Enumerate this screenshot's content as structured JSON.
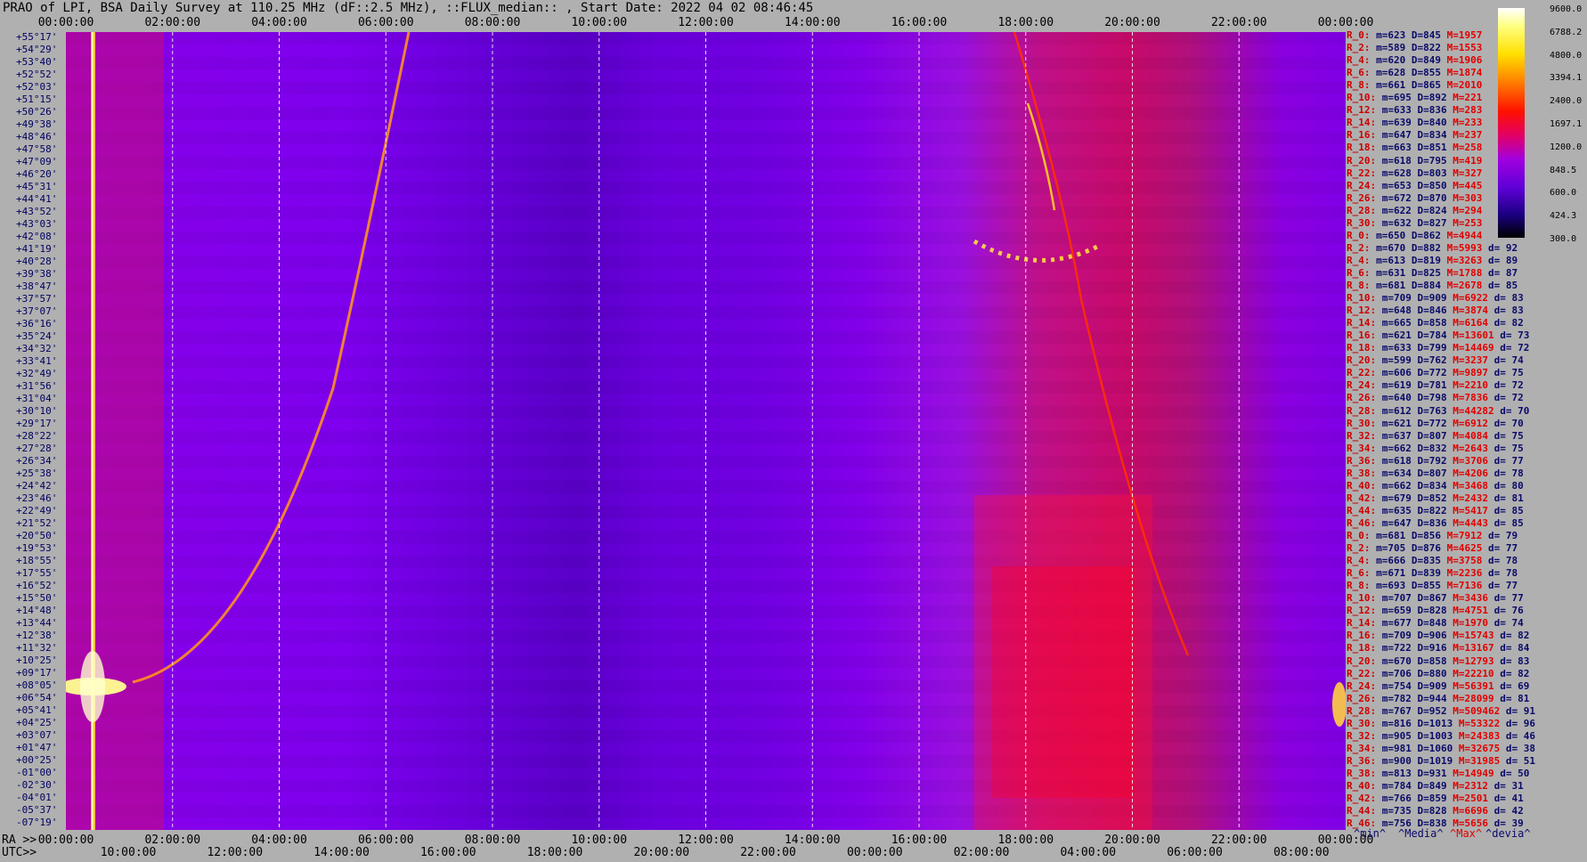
{
  "title": "PRAO of LPI, BSA Daily Survey at 110.25 MHz (dF::2.5 MHz), ::FLUX_median:: , Start Date: 2022 04 02 08:46:45",
  "top_ticks": [
    "00:00:00",
    "02:00:00",
    "04:00:00",
    "06:00:00",
    "08:00:00",
    "10:00:00",
    "12:00:00",
    "14:00:00",
    "16:00:00",
    "18:00:00",
    "20:00:00",
    "22:00:00",
    "00:00:00"
  ],
  "ra_label": "RA >>",
  "utc_label": "UTC>>",
  "bottom_ra_ticks": [
    "00:00:00",
    "02:00:00",
    "04:00:00",
    "06:00:00",
    "08:00:00",
    "10:00:00",
    "12:00:00",
    "14:00:00",
    "16:00:00",
    "18:00:00",
    "20:00:00",
    "22:00:00",
    "00:00:00"
  ],
  "bottom_utc_ticks": [
    "10:00:00",
    "12:00:00",
    "14:00:00",
    "16:00:00",
    "18:00:00",
    "20:00:00",
    "22:00:00",
    "00:00:00",
    "02:00:00",
    "04:00:00",
    "06:00:00",
    "08:00:00"
  ],
  "declinations": [
    "+55°17'",
    "+54°29'",
    "+53°40'",
    "+52°52'",
    "+52°03'",
    "+51°15'",
    "+50°26'",
    "+49°38'",
    "+48°46'",
    "+47°58'",
    "+47°09'",
    "+46°20'",
    "+45°31'",
    "+44°41'",
    "+43°52'",
    "+43°03'",
    "+42°08'",
    "+41°19'",
    "+40°28'",
    "+39°38'",
    "+38°47'",
    "+37°57'",
    "+37°07'",
    "+36°16'",
    "+35°24'",
    "+34°32'",
    "+33°41'",
    "+32°49'",
    "+31°56'",
    "+31°04'",
    "+30°10'",
    "+29°17'",
    "+28°22'",
    "+27°28'",
    "+26°34'",
    "+25°38'",
    "+24°42'",
    "+23°46'",
    "+22°49'",
    "+21°52'",
    "+20°50'",
    "+19°53'",
    "+18°55'",
    "+17°55'",
    "+16°52'",
    "+15°50'",
    "+14°48'",
    "+13°44'",
    "+12°38'",
    "+11°32'",
    "+10°25'",
    "+09°17'",
    "+08°05'",
    "+06°54'",
    "+05°41'",
    "+04°25'",
    "+03°07'",
    "+01°47'",
    "+00°25'",
    "-01°00'",
    "-02°30'",
    "-04°01'",
    "-05°37'",
    "-07°19'"
  ],
  "stats_rows": [
    {
      "n": "R_0:",
      "min": "m=623",
      "med": "D=845",
      "max": "M=1957",
      "dev": ""
    },
    {
      "n": "R_2:",
      "min": "m=589",
      "med": "D=822",
      "max": "M=1553",
      "dev": ""
    },
    {
      "n": "R_4:",
      "min": "m=620",
      "med": "D=849",
      "max": "M=1906",
      "dev": ""
    },
    {
      "n": "R_6:",
      "min": "m=628",
      "med": "D=855",
      "max": "M=1874",
      "dev": ""
    },
    {
      "n": "R_8:",
      "min": "m=661",
      "med": "D=865",
      "max": "M=2010",
      "dev": ""
    },
    {
      "n": "R_10:",
      "min": "m=695",
      "med": "D=892",
      "max": "M=221",
      "dev": ""
    },
    {
      "n": "R_12:",
      "min": "m=633",
      "med": "D=836",
      "max": "M=283",
      "dev": ""
    },
    {
      "n": "R_14:",
      "min": "m=639",
      "med": "D=840",
      "max": "M=233",
      "dev": ""
    },
    {
      "n": "R_16:",
      "min": "m=647",
      "med": "D=834",
      "max": "M=237",
      "dev": ""
    },
    {
      "n": "R_18:",
      "min": "m=663",
      "med": "D=851",
      "max": "M=258",
      "dev": ""
    },
    {
      "n": "R_20:",
      "min": "m=618",
      "med": "D=795",
      "max": "M=419",
      "dev": ""
    },
    {
      "n": "R_22:",
      "min": "m=628",
      "med": "D=803",
      "max": "M=327",
      "dev": ""
    },
    {
      "n": "R_24:",
      "min": "m=653",
      "med": "D=850",
      "max": "M=445",
      "dev": ""
    },
    {
      "n": "R_26:",
      "min": "m=672",
      "med": "D=870",
      "max": "M=303",
      "dev": ""
    },
    {
      "n": "R_28:",
      "min": "m=622",
      "med": "D=824",
      "max": "M=294",
      "dev": ""
    },
    {
      "n": "R_30:",
      "min": "m=632",
      "med": "D=827",
      "max": "M=253",
      "dev": ""
    },
    {
      "n": "R_0:",
      "min": "m=650",
      "med": "D=862",
      "max": "M=4944",
      "dev": ""
    },
    {
      "n": "R_2:",
      "min": "m=670",
      "med": "D=882",
      "max": "M=5993",
      "dev": "d= 92"
    },
    {
      "n": "R_4:",
      "min": "m=613",
      "med": "D=819",
      "max": "M=3263",
      "dev": "d= 89"
    },
    {
      "n": "R_6:",
      "min": "m=631",
      "med": "D=825",
      "max": "M=1788",
      "dev": "d= 87"
    },
    {
      "n": "R_8:",
      "min": "m=681",
      "med": "D=884",
      "max": "M=2678",
      "dev": "d= 85"
    },
    {
      "n": "R_10:",
      "min": "m=709",
      "med": "D=909",
      "max": "M=6922",
      "dev": "d= 83"
    },
    {
      "n": "R_12:",
      "min": "m=648",
      "med": "D=846",
      "max": "M=3874",
      "dev": "d= 83"
    },
    {
      "n": "R_14:",
      "min": "m=665",
      "med": "D=858",
      "max": "M=6164",
      "dev": "d= 82"
    },
    {
      "n": "R_16:",
      "min": "m=621",
      "med": "D=784",
      "max": "M=13601",
      "dev": "d= 73"
    },
    {
      "n": "R_18:",
      "min": "m=633",
      "med": "D=799",
      "max": "M=14469",
      "dev": "d= 72"
    },
    {
      "n": "R_20:",
      "min": "m=599",
      "med": "D=762",
      "max": "M=3237",
      "dev": "d= 74"
    },
    {
      "n": "R_22:",
      "min": "m=606",
      "med": "D=772",
      "max": "M=9897",
      "dev": "d= 75"
    },
    {
      "n": "R_24:",
      "min": "m=619",
      "med": "D=781",
      "max": "M=2210",
      "dev": "d= 72"
    },
    {
      "n": "R_26:",
      "min": "m=640",
      "med": "D=798",
      "max": "M=7836",
      "dev": "d= 72"
    },
    {
      "n": "R_28:",
      "min": "m=612",
      "med": "D=763",
      "max": "M=44282",
      "dev": "d= 70"
    },
    {
      "n": "R_30:",
      "min": "m=621",
      "med": "D=772",
      "max": "M=6912",
      "dev": "d= 70"
    },
    {
      "n": "R_32:",
      "min": "m=637",
      "med": "D=807",
      "max": "M=4084",
      "dev": "d= 75"
    },
    {
      "n": "R_34:",
      "min": "m=662",
      "med": "D=832",
      "max": "M=2643",
      "dev": "d= 75"
    },
    {
      "n": "R_36:",
      "min": "m=618",
      "med": "D=792",
      "max": "M=3706",
      "dev": "d= 77"
    },
    {
      "n": "R_38:",
      "min": "m=634",
      "med": "D=807",
      "max": "M=4206",
      "dev": "d= 78"
    },
    {
      "n": "R_40:",
      "min": "m=662",
      "med": "D=834",
      "max": "M=3468",
      "dev": "d= 80"
    },
    {
      "n": "R_42:",
      "min": "m=679",
      "med": "D=852",
      "max": "M=2432",
      "dev": "d= 81"
    },
    {
      "n": "R_44:",
      "min": "m=635",
      "med": "D=822",
      "max": "M=5417",
      "dev": "d= 85"
    },
    {
      "n": "R_46:",
      "min": "m=647",
      "med": "D=836",
      "max": "M=4443",
      "dev": "d= 85"
    },
    {
      "n": "R_0:",
      "min": "m=681",
      "med": "D=856",
      "max": "M=7912",
      "dev": "d= 79"
    },
    {
      "n": "R_2:",
      "min": "m=705",
      "med": "D=876",
      "max": "M=4625",
      "dev": "d= 77"
    },
    {
      "n": "R_4:",
      "min": "m=666",
      "med": "D=835",
      "max": "M=3758",
      "dev": "d= 78"
    },
    {
      "n": "R_6:",
      "min": "m=671",
      "med": "D=839",
      "max": "M=2236",
      "dev": "d= 78"
    },
    {
      "n": "R_8:",
      "min": "m=693",
      "med": "D=855",
      "max": "M=7136",
      "dev": "d= 77"
    },
    {
      "n": "R_10:",
      "min": "m=707",
      "med": "D=867",
      "max": "M=3436",
      "dev": "d= 77"
    },
    {
      "n": "R_12:",
      "min": "m=659",
      "med": "D=828",
      "max": "M=4751",
      "dev": "d= 76"
    },
    {
      "n": "R_14:",
      "min": "m=677",
      "med": "D=848",
      "max": "M=1970",
      "dev": "d= 74"
    },
    {
      "n": "R_16:",
      "min": "m=709",
      "med": "D=906",
      "max": "M=15743",
      "dev": "d= 82"
    },
    {
      "n": "R_18:",
      "min": "m=722",
      "med": "D=916",
      "max": "M=13167",
      "dev": "d= 84"
    },
    {
      "n": "R_20:",
      "min": "m=670",
      "med": "D=858",
      "max": "M=12793",
      "dev": "d= 83"
    },
    {
      "n": "R_22:",
      "min": "m=706",
      "med": "D=880",
      "max": "M=22210",
      "dev": "d= 82"
    },
    {
      "n": "R_24:",
      "min": "m=754",
      "med": "D=909",
      "max": "M=56391",
      "dev": "d= 69"
    },
    {
      "n": "R_26:",
      "min": "m=782",
      "med": "D=944",
      "max": "M=28099",
      "dev": "d= 81"
    },
    {
      "n": "R_28:",
      "min": "m=767",
      "med": "D=952",
      "max": "M=509462",
      "dev": "d= 91"
    },
    {
      "n": "R_30:",
      "min": "m=816",
      "med": "D=1013",
      "max": "M=53322",
      "dev": "d= 96"
    },
    {
      "n": "R_32:",
      "min": "m=905",
      "med": "D=1003",
      "max": "M=24383",
      "dev": "d= 46"
    },
    {
      "n": "R_34:",
      "min": "m=981",
      "med": "D=1060",
      "max": "M=32675",
      "dev": "d= 38"
    },
    {
      "n": "R_36:",
      "min": "m=900",
      "med": "D=1019",
      "max": "M=31985",
      "dev": "d= 51"
    },
    {
      "n": "R_38:",
      "min": "m=813",
      "med": "D=931",
      "max": "M=14949",
      "dev": "d= 50"
    },
    {
      "n": "R_40:",
      "min": "m=784",
      "med": "D=849",
      "max": "M=2312",
      "dev": "d= 31"
    },
    {
      "n": "R_42:",
      "min": "m=766",
      "med": "D=859",
      "max": "M=2501",
      "dev": "d= 41"
    },
    {
      "n": "R_44:",
      "min": "m=735",
      "med": "D=828",
      "max": "M=6696",
      "dev": "d= 42"
    },
    {
      "n": "R_46:",
      "min": "m=756",
      "med": "D=838",
      "max": "M=5656",
      "dev": "d= 39"
    }
  ],
  "legend": {
    "min": "^min^",
    "median": "^Media^",
    "max": "^Max^",
    "dev": "^devia^"
  },
  "colors": {
    "min": "#0a0a6a",
    "median": "#0a0a6a",
    "max": "#e00000",
    "dev": "#0a0a6a",
    "row_name": "#cc0000"
  },
  "chart_data": {
    "type": "heatmap",
    "title": "PRAO of LPI, BSA Daily Survey at 110.25 MHz (dF::2.5 MHz), ::FLUX_median:: , Start Date: 2022 04 02 08:46:45",
    "x_axis_top": "RA 00:00:00 → 00:00:00 (2h ticks)",
    "x_axis_bottom_utc": "10:00:00 → 08:00:00 (2h ticks)",
    "y_axis": "declination +55°17' → -07°19' (64 beams)",
    "colorscale": [
      {
        "value": 9600.0,
        "color": "#ffffff"
      },
      {
        "value": 6788.2,
        "color": "#ffff80"
      },
      {
        "value": 4800.0,
        "color": "#ffe000"
      },
      {
        "value": 3394.1,
        "color": "#ffa000"
      },
      {
        "value": 2400.0,
        "color": "#ff5000"
      },
      {
        "value": 1697.1,
        "color": "#ff1000"
      },
      {
        "value": 1200.0,
        "color": "#e0006a"
      },
      {
        "value": 848.5,
        "color": "#a000e0"
      },
      {
        "value": 600.0,
        "color": "#6000d8"
      },
      {
        "value": 424.3,
        "color": "#1a0080"
      },
      {
        "value": 300.0,
        "color": "#000000"
      }
    ],
    "grid": true,
    "vertical_gridlines": "dashed white every 2h RA"
  }
}
